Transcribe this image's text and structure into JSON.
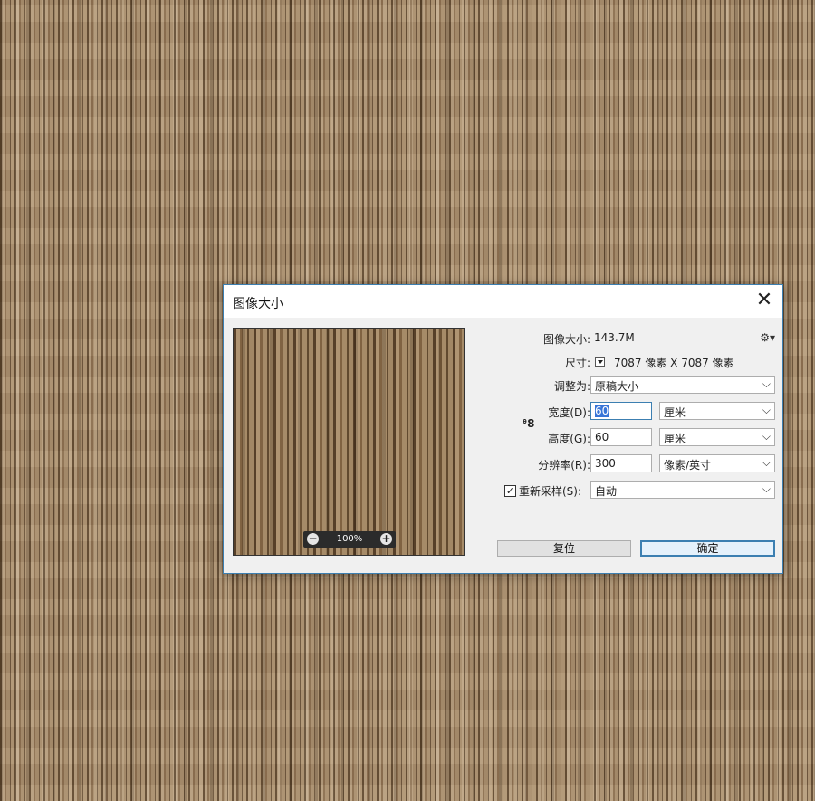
{
  "dialog": {
    "title": "图像大小",
    "close_label": "✕"
  },
  "preview": {
    "zoom_level": "100%",
    "zoom_out": "−",
    "zoom_in": "+"
  },
  "info": {
    "image_size_label": "图像大小:",
    "image_size_value": "143.7M",
    "dimensions_label": "尺寸:",
    "dimensions_value": "7087 像素  X  7087 像素"
  },
  "fit_to": {
    "label": "调整为:",
    "value": "原稿大小"
  },
  "width": {
    "label": "宽度(D):",
    "value": "60",
    "unit": "厘米"
  },
  "height": {
    "label": "高度(G):",
    "value": "60",
    "unit": "厘米"
  },
  "resolution": {
    "label": "分辨率(R):",
    "value": "300",
    "unit": "像素/英寸"
  },
  "resample": {
    "label": "重新采样(S):",
    "checked": true,
    "check_glyph": "✓",
    "value": "自动"
  },
  "buttons": {
    "reset": "复位",
    "ok": "确定"
  },
  "icons": {
    "gear": "gear-icon",
    "link": "chain-link-icon",
    "chevron": "chevron-down-icon"
  },
  "colors": {
    "accent": "#3c7fb1",
    "selection": "#3875d7",
    "dialog_bg": "#f0f0f0"
  }
}
